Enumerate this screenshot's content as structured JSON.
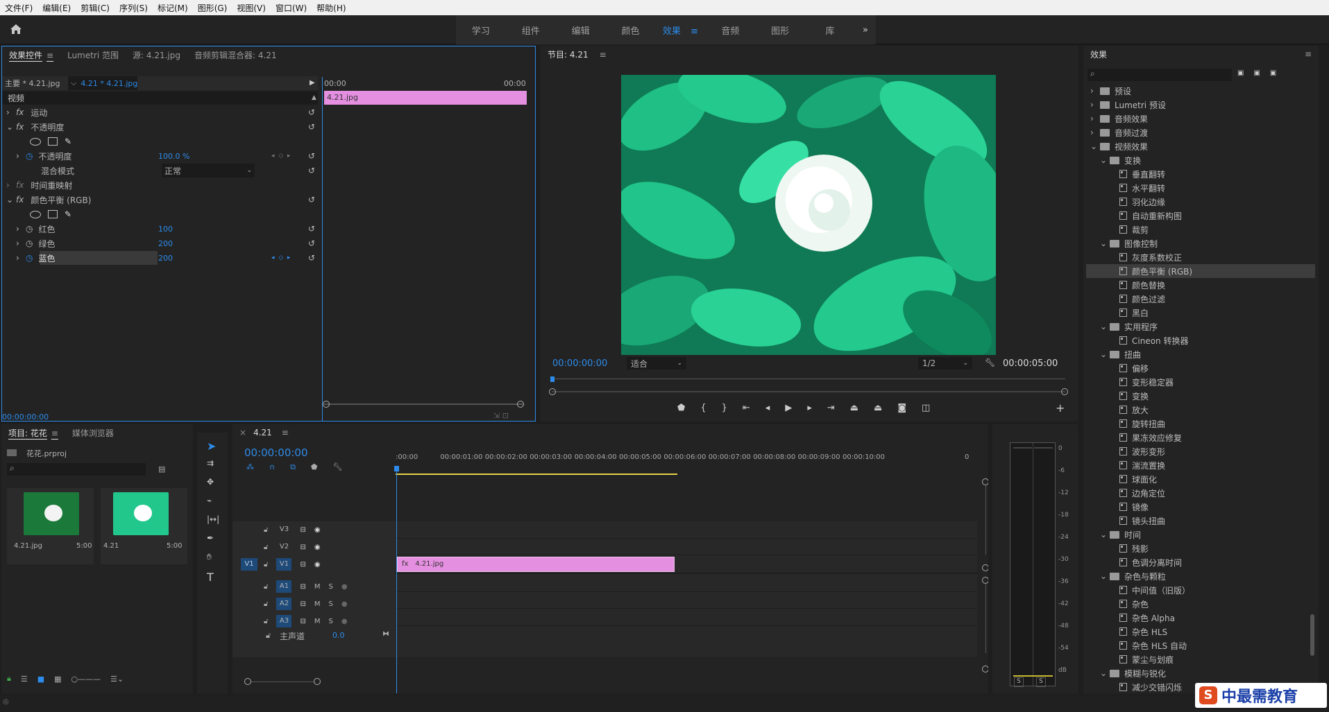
{
  "menu": [
    "文件(F)",
    "编辑(E)",
    "剪辑(C)",
    "序列(S)",
    "标记(M)",
    "图形(G)",
    "视图(V)",
    "窗口(W)",
    "帮助(H)"
  ],
  "workspaces": [
    {
      "label": "学习",
      "active": false
    },
    {
      "label": "组件",
      "active": false
    },
    {
      "label": "编辑",
      "active": false
    },
    {
      "label": "颜色",
      "active": false
    },
    {
      "label": "效果",
      "active": true
    },
    {
      "label": "音频",
      "active": false
    },
    {
      "label": "图形",
      "active": false
    },
    {
      "label": "库",
      "active": false
    }
  ],
  "colors": {
    "accent": "#2d8ceb",
    "clip": "#e58fe0",
    "panel": "#232323",
    "selected": "#3d3d3d"
  },
  "effect_controls": {
    "tabs": [
      "效果控件",
      "Lumetri 范围",
      "源: 4.21.jpg",
      "音频剪辑混合器: 4.21"
    ],
    "master": "主要 * 4.21.jpg",
    "seq": "4.21 * 4.21.jpg",
    "tc_start": "00:00",
    "tc_end": "00:00",
    "clip_name": "4.21.jpg",
    "video": "视频",
    "motion": "运动",
    "opacity": "不透明度",
    "opacity_param": "不透明度",
    "opacity_val": "100.0 %",
    "blend": "混合模式",
    "blend_val": "正常",
    "time_remap": "时间重映射",
    "color_balance": "颜色平衡 (RGB)",
    "red": "红色",
    "red_val": "100",
    "green": "绿色",
    "green_val": "200",
    "blue": "蓝色",
    "blue_val": "200",
    "timecode": "00:00:00:00"
  },
  "program": {
    "title": "节目: 4.21",
    "timecode": "00:00:00:00",
    "fit": "适合",
    "res": "1/2",
    "duration": "00:00:05:00"
  },
  "project": {
    "tabs": [
      "项目: 花花",
      "媒体浏览器"
    ],
    "file": "花花.prproj",
    "items": [
      {
        "name": "4.21.jpg",
        "dur": "5:00"
      },
      {
        "name": "4.21",
        "dur": "5:00"
      }
    ]
  },
  "timeline": {
    "tab": "4.21",
    "timecode": "00:00:00:00",
    "ruler": [
      ":00:00",
      "00:00:01:00",
      "00:00:02:00",
      "00:00:03:00",
      "00:00:04:00",
      "00:00:05:00",
      "00:00:06:00",
      "00:00:07:00",
      "00:00:08:00",
      "00:00:09:00",
      "00:00:10:00",
      "0"
    ],
    "tracks_v": [
      "V3",
      "V2",
      "V1"
    ],
    "tracks_a": [
      "A1",
      "A2",
      "A3"
    ],
    "src_v": "V1",
    "master": "主声道",
    "master_val": "0.0",
    "clip": "4.21.jpg",
    "m": "M",
    "s": "S"
  },
  "meter": {
    "labels": [
      "0",
      "-6",
      "-12",
      "-18",
      "-24",
      "-30",
      "-36",
      "-42",
      "-48",
      "-54",
      "dB"
    ],
    "solo": [
      "S",
      "S"
    ]
  },
  "effects": {
    "title": "效果",
    "tree": [
      {
        "label": "预设",
        "level": 0,
        "type": "folder",
        "open": false
      },
      {
        "label": "Lumetri 预设",
        "level": 0,
        "type": "folder",
        "open": false
      },
      {
        "label": "音频效果",
        "level": 0,
        "type": "folder",
        "open": false
      },
      {
        "label": "音频过渡",
        "level": 0,
        "type": "folder",
        "open": false
      },
      {
        "label": "视频效果",
        "level": 0,
        "type": "folder",
        "open": true
      },
      {
        "label": "变换",
        "level": 1,
        "type": "folder",
        "open": true
      },
      {
        "label": "垂直翻转",
        "level": 2,
        "type": "fx"
      },
      {
        "label": "水平翻转",
        "level": 2,
        "type": "fx"
      },
      {
        "label": "羽化边缘",
        "level": 2,
        "type": "fx"
      },
      {
        "label": "自动重新构图",
        "level": 2,
        "type": "fx"
      },
      {
        "label": "裁剪",
        "level": 2,
        "type": "fx"
      },
      {
        "label": "图像控制",
        "level": 1,
        "type": "folder",
        "open": true
      },
      {
        "label": "灰度系数校正",
        "level": 2,
        "type": "fx"
      },
      {
        "label": "颜色平衡 (RGB)",
        "level": 2,
        "type": "fx",
        "selected": true
      },
      {
        "label": "颜色替换",
        "level": 2,
        "type": "fx"
      },
      {
        "label": "颜色过滤",
        "level": 2,
        "type": "fx"
      },
      {
        "label": "黑白",
        "level": 2,
        "type": "fx"
      },
      {
        "label": "实用程序",
        "level": 1,
        "type": "folder",
        "open": true
      },
      {
        "label": "Cineon 转换器",
        "level": 2,
        "type": "fx"
      },
      {
        "label": "扭曲",
        "level": 1,
        "type": "folder",
        "open": true
      },
      {
        "label": "偏移",
        "level": 2,
        "type": "fx"
      },
      {
        "label": "变形稳定器",
        "level": 2,
        "type": "fx"
      },
      {
        "label": "变换",
        "level": 2,
        "type": "fx"
      },
      {
        "label": "放大",
        "level": 2,
        "type": "fx"
      },
      {
        "label": "旋转扭曲",
        "level": 2,
        "type": "fx"
      },
      {
        "label": "果冻效应修复",
        "level": 2,
        "type": "fx"
      },
      {
        "label": "波形变形",
        "level": 2,
        "type": "fx"
      },
      {
        "label": "湍流置换",
        "level": 2,
        "type": "fx"
      },
      {
        "label": "球面化",
        "level": 2,
        "type": "fx"
      },
      {
        "label": "边角定位",
        "level": 2,
        "type": "fx"
      },
      {
        "label": "镜像",
        "level": 2,
        "type": "fx"
      },
      {
        "label": "镜头扭曲",
        "level": 2,
        "type": "fx"
      },
      {
        "label": "时间",
        "level": 1,
        "type": "folder",
        "open": true
      },
      {
        "label": "残影",
        "level": 2,
        "type": "fx"
      },
      {
        "label": "色调分离时间",
        "level": 2,
        "type": "fx"
      },
      {
        "label": "杂色与颗粒",
        "level": 1,
        "type": "folder",
        "open": true
      },
      {
        "label": "中间值（旧版）",
        "level": 2,
        "type": "fx"
      },
      {
        "label": "杂色",
        "level": 2,
        "type": "fx"
      },
      {
        "label": "杂色 Alpha",
        "level": 2,
        "type": "fx"
      },
      {
        "label": "杂色 HLS",
        "level": 2,
        "type": "fx"
      },
      {
        "label": "杂色 HLS 自动",
        "level": 2,
        "type": "fx"
      },
      {
        "label": "蒙尘与划痕",
        "level": 2,
        "type": "fx"
      },
      {
        "label": "模糊与锐化",
        "level": 1,
        "type": "folder",
        "open": true
      },
      {
        "label": "减少交错闪烁",
        "level": 2,
        "type": "fx"
      }
    ]
  },
  "watermark": "中最需教育"
}
